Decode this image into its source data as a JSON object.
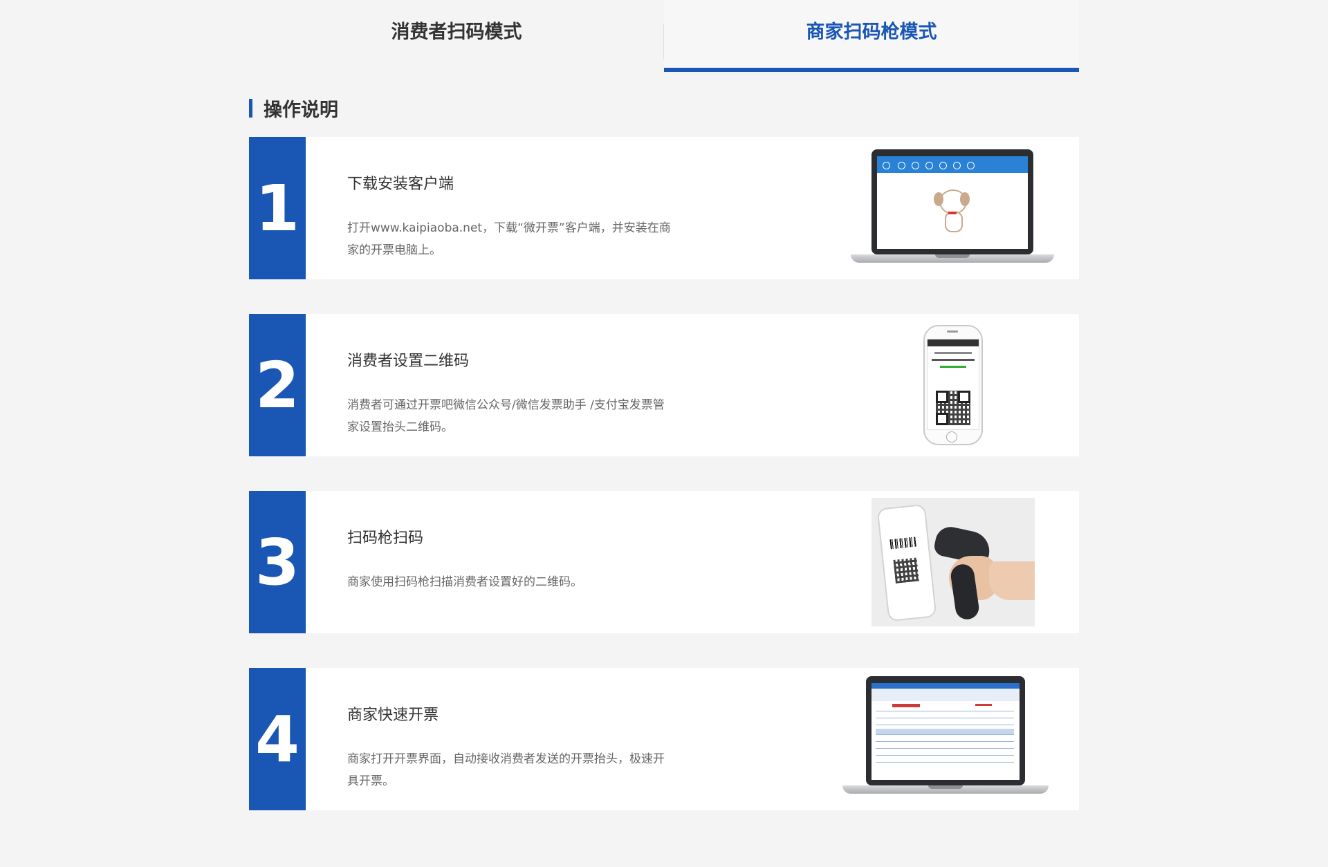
{
  "tabs": [
    {
      "label": "消费者扫码模式",
      "active": false
    },
    {
      "label": "商家扫码枪模式",
      "active": true
    }
  ],
  "section": {
    "title": "操作说明"
  },
  "steps": [
    {
      "number": "1",
      "title": "下载安装客户端",
      "desc": "打开www.kaipiaoba.net，下载“微开票”客户端，并安装在商家的开票电脑上。",
      "illustration": "laptop-client-icon"
    },
    {
      "number": "2",
      "title": "消费者设置二维码",
      "desc": "消费者可通过开票吧微信公众号/微信发票助手 /支付宝发票管家设置抬头二维码。",
      "illustration": "phone-qrcode-icon"
    },
    {
      "number": "3",
      "title": "扫码枪扫码",
      "desc": "商家使用扫码枪扫描消费者设置好的二维码。",
      "illustration": "barcode-scanner-icon"
    },
    {
      "number": "4",
      "title": "商家快速开票",
      "desc": "商家打开开票界面，自动接收消费者发送的开票抬头，极速开具开票。",
      "illustration": "laptop-invoice-icon"
    }
  ],
  "colors": {
    "accent": "#1a56b4",
    "background": "#f4f4f4",
    "card": "#ffffff"
  }
}
